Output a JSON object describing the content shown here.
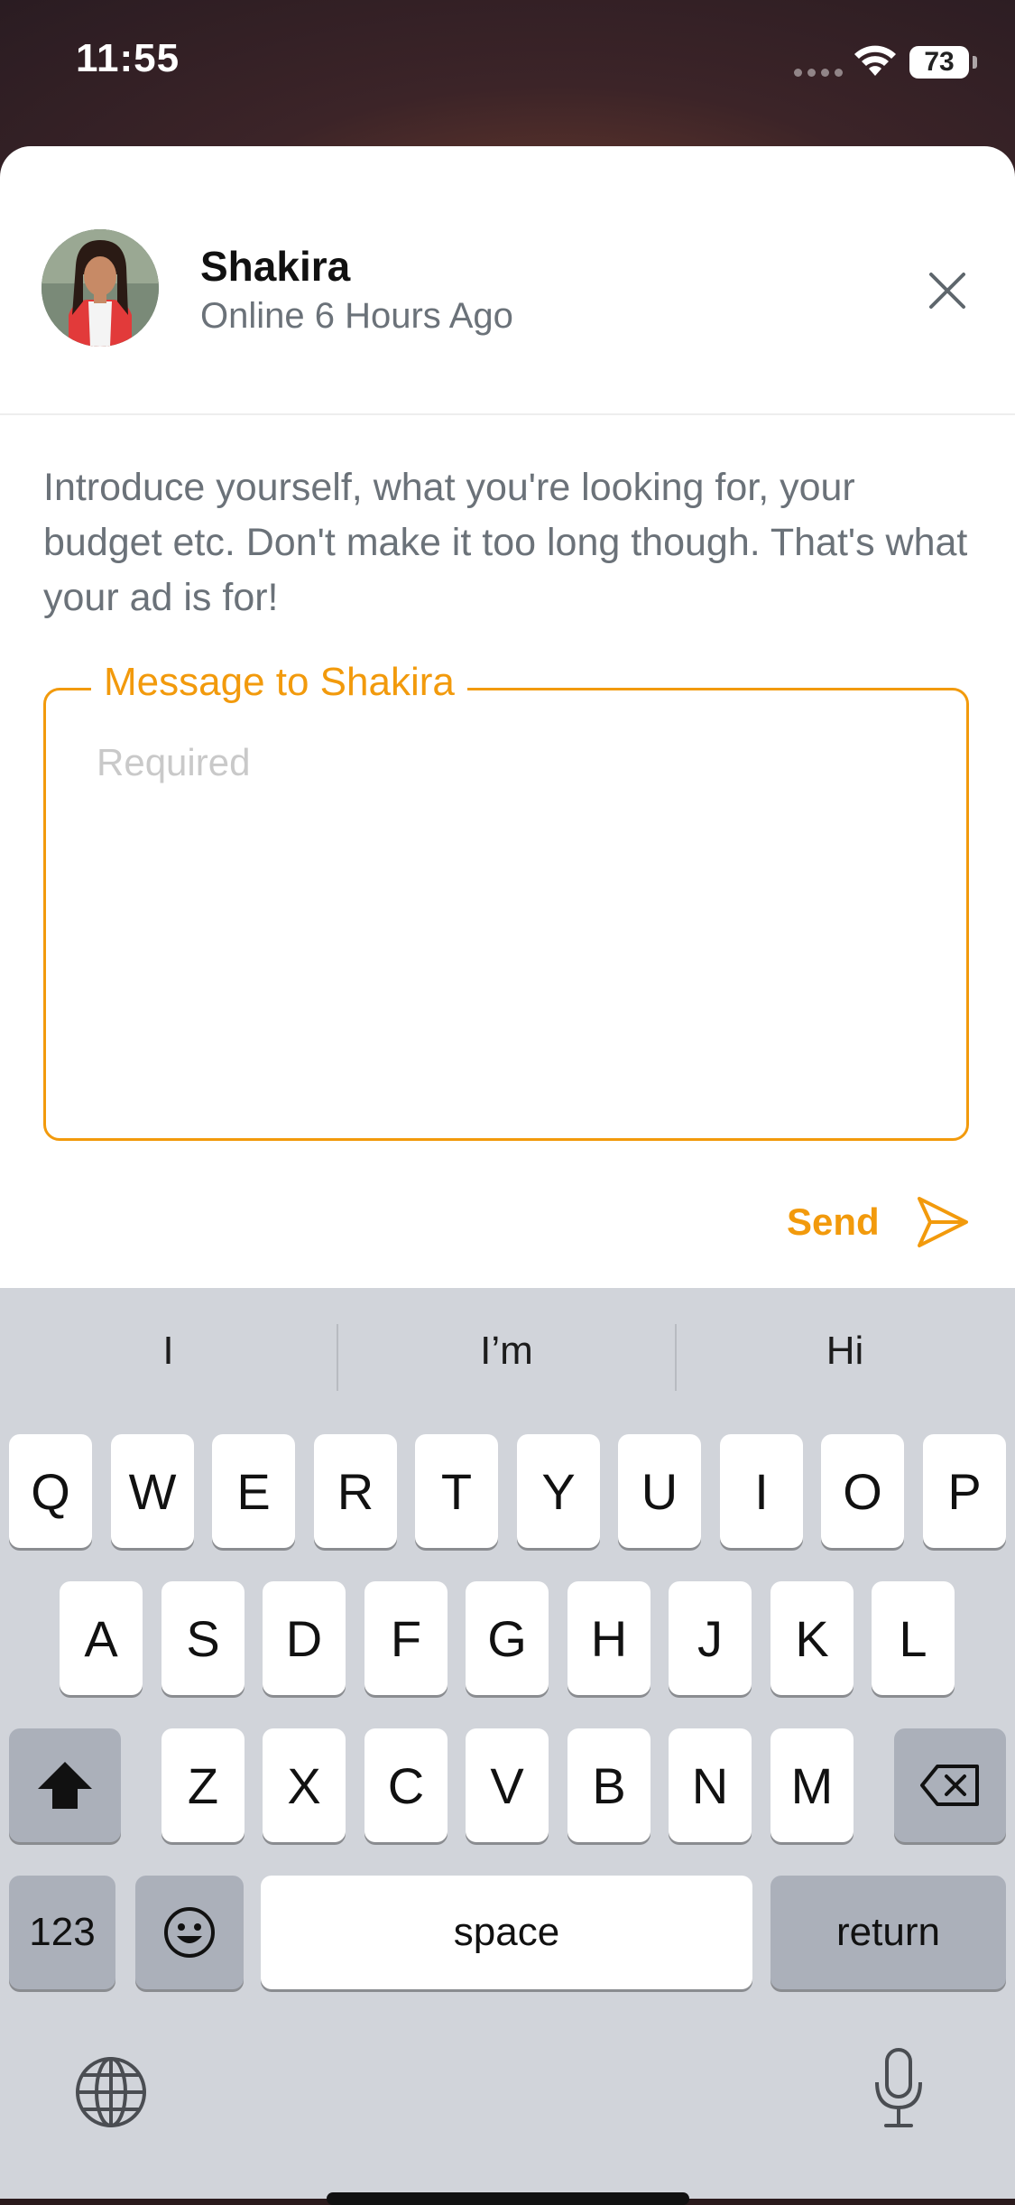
{
  "status_bar": {
    "time": "11:55",
    "battery": "73"
  },
  "header": {
    "name": "Shakira",
    "status": "Online 6 Hours Ago"
  },
  "intro_text": "Introduce yourself, what you're looking for, your budget etc. Don't make it too long though. That's what your ad is for!",
  "message": {
    "label": "Message to Shakira",
    "placeholder": "Required",
    "value": ""
  },
  "send_label": "Send",
  "keyboard": {
    "suggestions": [
      "I",
      "I’m",
      "Hi"
    ],
    "row1": [
      "Q",
      "W",
      "E",
      "R",
      "T",
      "Y",
      "U",
      "I",
      "O",
      "P"
    ],
    "row2": [
      "A",
      "S",
      "D",
      "F",
      "G",
      "H",
      "J",
      "K",
      "L"
    ],
    "row3": [
      "Z",
      "X",
      "C",
      "V",
      "B",
      "N",
      "M"
    ],
    "numbers_label": "123",
    "space_label": "space",
    "return_label": "return"
  },
  "colors": {
    "accent": "#f29a0c",
    "muted_text": "#6b7279",
    "keyboard_bg": "#d1d4da"
  }
}
